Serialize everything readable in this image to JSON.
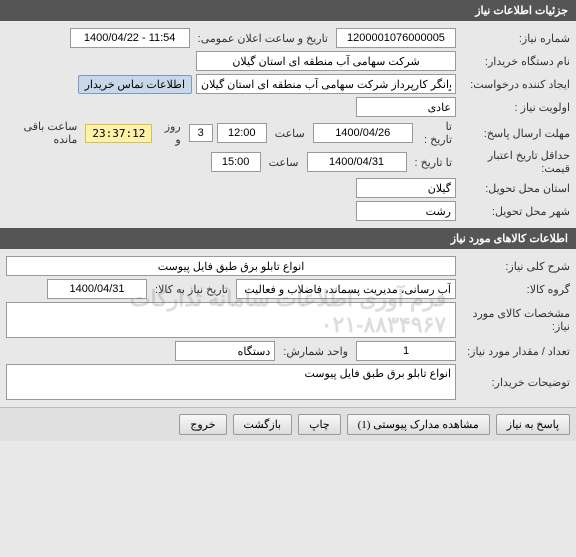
{
  "headers": {
    "need_info": "جزئیات اطلاعات نیاز",
    "goods_info": "اطلاعات کالاهای مورد نیاز"
  },
  "labels": {
    "need_number": "شماره نیاز:",
    "announce_datetime": "تاریخ و ساعت اعلان عمومی:",
    "buyer_org": "نام دستگاه خریدار:",
    "request_creator": "ایجاد کننده درخواست:",
    "buyer_contact_btn": "اطلاعات تماس خریدار",
    "priority": "اولویت نیاز :",
    "response_deadline": "مهلت ارسال پاسخ:",
    "until_date": "تا تاریخ :",
    "hour": "ساعت",
    "days_and": "روز و",
    "time_remaining": "ساعت باقی مانده",
    "min_validity": "حداقل تاریخ اعتبار قیمت:",
    "delivery_province": "استان محل تحویل:",
    "delivery_city": "شهر محل تحویل:",
    "general_desc": "شرح کلی نیاز:",
    "goods_group": "گروه کالا:",
    "need_date": "تاریخ نیاز به کالا:",
    "goods_spec": "مشخصات کالای مورد نیاز:",
    "qty": "تعداد / مقدار مورد نیاز:",
    "unit": "واحد شمارش:",
    "buyer_notes": "توضیحات خریدار:"
  },
  "values": {
    "need_number": "1200001076000005",
    "announce_datetime": "1400/04/22 - 11:54",
    "buyer_org": "شرکت سهامی آب منطقه ای استان گیلان",
    "request_creator": "غلامرضا خوانگر کارپرداز شرکت سهامی آب منطقه ای استان گیلان",
    "priority": "عادی",
    "deadline_date": "1400/04/26",
    "deadline_time": "12:00",
    "days_remaining": "3",
    "countdown": "23:37:12",
    "validity_date": "1400/04/31",
    "validity_time": "15:00",
    "province": "گیلان",
    "city": "رشت",
    "general_desc": "انواع تابلو برق طبق فایل پیوست",
    "goods_group": "آب رسانی، مدیریت پسماند، فاضلاب و فعالیت ها",
    "need_date": "1400/04/31",
    "goods_spec": "",
    "qty": "1",
    "unit": "دستگاه",
    "buyer_notes": "انواع تابلو برق طبق فایل پیوست"
  },
  "watermark": "فرم آوری اطلاعات سامانه تدارکات",
  "watermark_phone": "۰۲۱-۸۸۳۴۹۶۷",
  "buttons": {
    "respond": "پاسخ به نیاز",
    "view_attachments": "مشاهده مدارک پیوستی (1)",
    "print": "چاپ",
    "back": "بازگشت",
    "exit": "خروج"
  }
}
